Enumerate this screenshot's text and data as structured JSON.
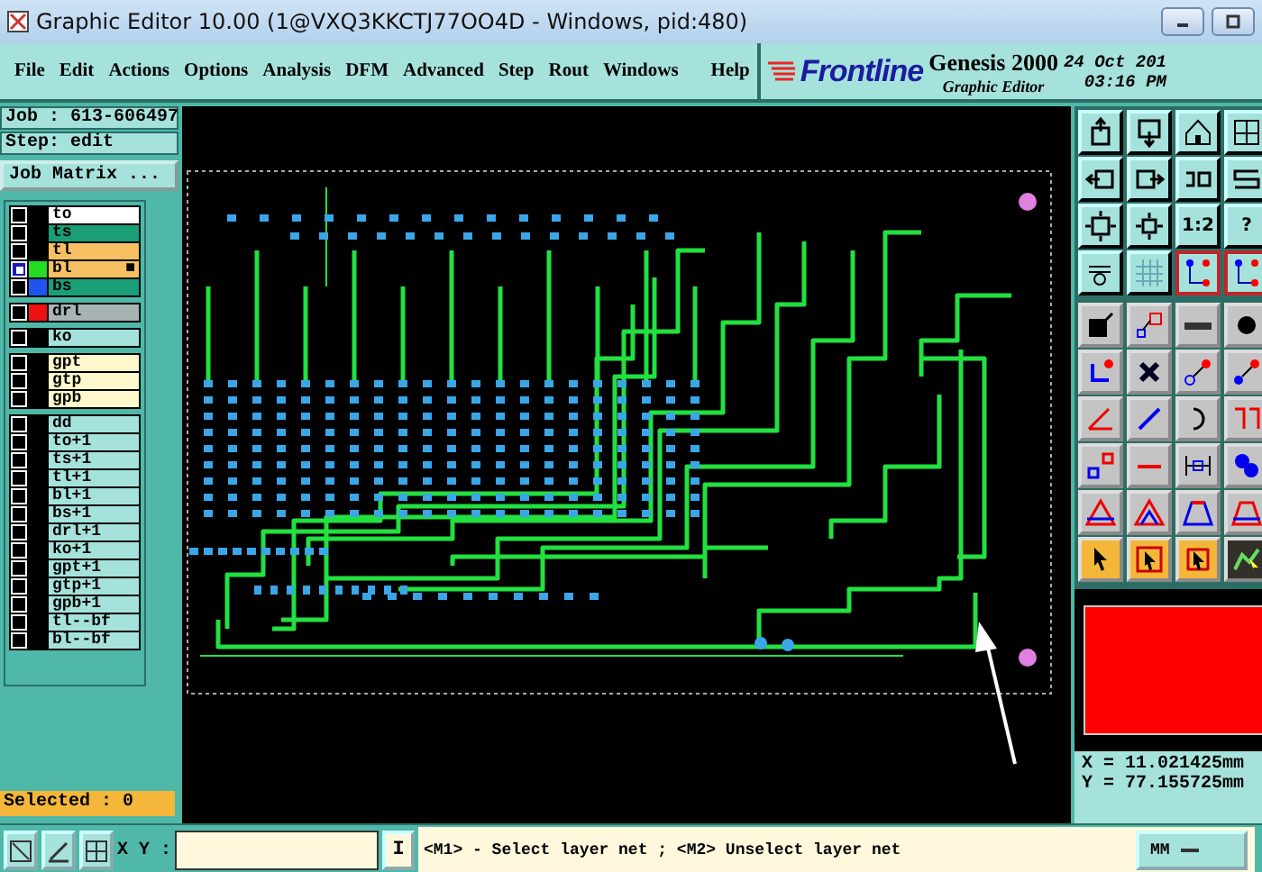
{
  "window": {
    "title": "Graphic Editor 10.00 (1@VXQ3KKCTJ77OO4D - Windows, pid:480)"
  },
  "menu": [
    "File",
    "Edit",
    "Actions",
    "Options",
    "Analysis",
    "DFM",
    "Advanced",
    "Step",
    "Rout",
    "Windows",
    "Help"
  ],
  "brand": {
    "logo": "Frontline",
    "product": "Genesis 2000",
    "subtitle": "Graphic Editor",
    "date": "24 Oct 201",
    "time": "03:16 PM"
  },
  "job": {
    "job": "Job : 613-606497",
    "step": "Step: edit",
    "matrix_button": "Job Matrix ..."
  },
  "layer_groups": [
    {
      "layers": [
        {
          "name": "to",
          "color": "#ffffff",
          "selected": false
        },
        {
          "name": "ts",
          "color": "#1a9e78",
          "selected": false
        },
        {
          "name": "tl",
          "color": "#f6c062",
          "selected": false
        },
        {
          "name": "bl",
          "color": "#f6c062",
          "selected": true,
          "swatch": {
            "color": "#22dd22"
          },
          "mark": "■"
        },
        {
          "name": "bs",
          "color": "#1a9e78",
          "selected": false,
          "swatch": {
            "color": "#1f55ee"
          }
        }
      ]
    },
    {
      "layers": [
        {
          "name": "drl",
          "color": "#a8b4b4",
          "selected": false,
          "swatch": {
            "color": "#ee1111"
          }
        }
      ]
    },
    {
      "layers": [
        {
          "name": "ko",
          "color": "#a6e2dc",
          "selected": false
        }
      ]
    },
    {
      "layers": [
        {
          "name": "gpt",
          "color": "#fff8cc",
          "selected": false
        },
        {
          "name": "gtp",
          "color": "#fff8cc",
          "selected": false
        },
        {
          "name": "gpb",
          "color": "#fff8cc",
          "selected": false
        }
      ]
    },
    {
      "layers": [
        {
          "name": "dd",
          "color": "#a6e2dc",
          "selected": false
        },
        {
          "name": "to+1",
          "color": "#a6e2dc",
          "selected": false
        },
        {
          "name": "ts+1",
          "color": "#a6e2dc",
          "selected": false
        },
        {
          "name": "tl+1",
          "color": "#a6e2dc",
          "selected": false
        },
        {
          "name": "bl+1",
          "color": "#a6e2dc",
          "selected": false
        },
        {
          "name": "bs+1",
          "color": "#a6e2dc",
          "selected": false
        },
        {
          "name": "drl+1",
          "color": "#a6e2dc",
          "selected": false
        },
        {
          "name": "ko+1",
          "color": "#a6e2dc",
          "selected": false
        },
        {
          "name": "gpt+1",
          "color": "#a6e2dc",
          "selected": false
        },
        {
          "name": "gtp+1",
          "color": "#a6e2dc",
          "selected": false
        },
        {
          "name": "gpb+1",
          "color": "#a6e2dc",
          "selected": false
        },
        {
          "name": "tl--bf",
          "color": "#a6e2dc",
          "selected": false
        },
        {
          "name": "bl--bf",
          "color": "#a6e2dc",
          "selected": false
        }
      ]
    }
  ],
  "selected_count": "Selected : 0",
  "tool_rows": [
    [
      {
        "kind": "view"
      },
      {
        "kind": "view"
      },
      {
        "kind": "view"
      },
      {
        "kind": "view"
      }
    ],
    [
      {
        "kind": "view"
      },
      {
        "kind": "view"
      },
      {
        "kind": "view"
      },
      {
        "kind": "view"
      }
    ],
    [
      {
        "kind": "view"
      },
      {
        "kind": "view"
      },
      {
        "kind": "view",
        "label": "1:2"
      },
      {
        "kind": "view",
        "label": "?"
      }
    ],
    [
      {
        "kind": "view"
      },
      {
        "kind": "view"
      },
      {
        "kind": "view",
        "selected": true
      },
      {
        "kind": "view",
        "selected": true
      }
    ],
    [
      {
        "kind": "edit"
      },
      {
        "kind": "edit"
      },
      {
        "kind": "edit"
      },
      {
        "kind": "edit"
      }
    ],
    [
      {
        "kind": "edit"
      },
      {
        "kind": "edit"
      },
      {
        "kind": "edit"
      },
      {
        "kind": "edit"
      }
    ],
    [
      {
        "kind": "edit"
      },
      {
        "kind": "edit"
      },
      {
        "kind": "edit"
      },
      {
        "kind": "edit"
      }
    ],
    [
      {
        "kind": "edit"
      },
      {
        "kind": "edit"
      },
      {
        "kind": "edit"
      },
      {
        "kind": "edit"
      }
    ],
    [
      {
        "kind": "edit"
      },
      {
        "kind": "edit"
      },
      {
        "kind": "edit"
      },
      {
        "kind": "edit"
      }
    ],
    [
      {
        "kind": "select"
      },
      {
        "kind": "select"
      },
      {
        "kind": "select"
      },
      {
        "kind": "dark"
      }
    ]
  ],
  "readout": {
    "x": "X = 11.021425mm",
    "y": "Y = 77.155725mm"
  },
  "bottom": {
    "xy_label": "X Y :",
    "command_button": "I",
    "message": "<M1> - Select layer net ; <M2> Unselect layer net",
    "units": "MM"
  }
}
